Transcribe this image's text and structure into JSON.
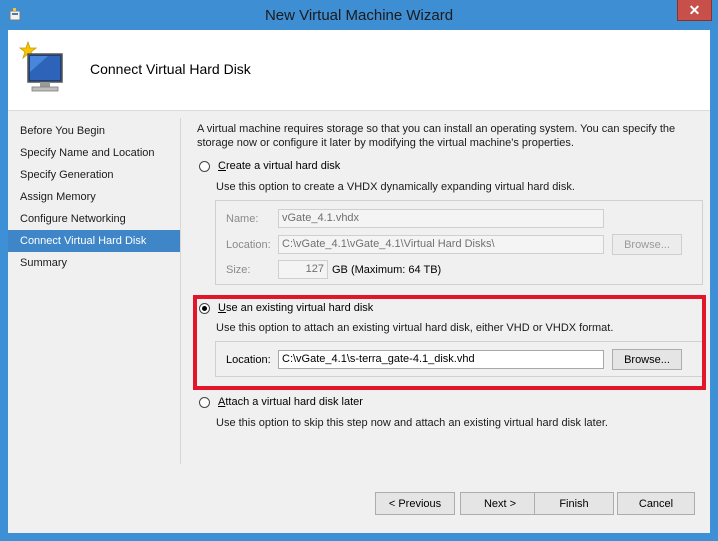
{
  "window": {
    "title": "New Virtual Machine Wizard",
    "close_glyph": "✕"
  },
  "header": {
    "title": "Connect Virtual Hard Disk"
  },
  "nav": {
    "items": [
      {
        "label": "Before You Begin"
      },
      {
        "label": "Specify Name and Location"
      },
      {
        "label": "Specify Generation"
      },
      {
        "label": "Assign Memory"
      },
      {
        "label": "Configure Networking"
      },
      {
        "label": "Connect Virtual Hard Disk"
      },
      {
        "label": "Summary"
      }
    ],
    "active_index": 5
  },
  "intro": "A virtual machine requires storage so that you can install an operating system. You can specify the storage now or configure it later by modifying the virtual machine's properties.",
  "option_create": {
    "label_accel": "C",
    "label_rest": "reate a virtual hard disk",
    "description": "Use this option to create a VHDX dynamically expanding virtual hard disk.",
    "name_label": "Name:",
    "name_value": "vGate_4.1.vhdx",
    "location_label": "Location:",
    "location_value": "C:\\vGate_4.1\\vGate_4.1\\Virtual Hard Disks\\",
    "browse_label": "Browse...",
    "size_label": "Size:",
    "size_value": "127",
    "size_unit": "GB (Maximum: 64 TB)",
    "selected": false
  },
  "option_existing": {
    "label_accel": "U",
    "label_rest": "se an existing virtual hard disk",
    "description": "Use this option to attach an existing virtual hard disk, either VHD or VHDX format.",
    "location_label": "Location:",
    "location_value": "C:\\vGate_4.1\\s-terra_gate-4.1_disk.vhd",
    "browse_label": "Browse...",
    "selected": true
  },
  "option_later": {
    "label_accel": "A",
    "label_rest": "ttach a virtual hard disk later",
    "description": "Use this option to skip this step now and attach an existing virtual hard disk later.",
    "selected": false
  },
  "footer": {
    "previous_label": "< Previous",
    "next_label": "Next >",
    "finish_label": "Finish",
    "cancel_label": "Cancel"
  },
  "colors": {
    "title_bar": "#3e8ed4",
    "nav_active": "#3f86c8",
    "highlight_border": "#e3152b",
    "close_button": "#c7504b"
  }
}
